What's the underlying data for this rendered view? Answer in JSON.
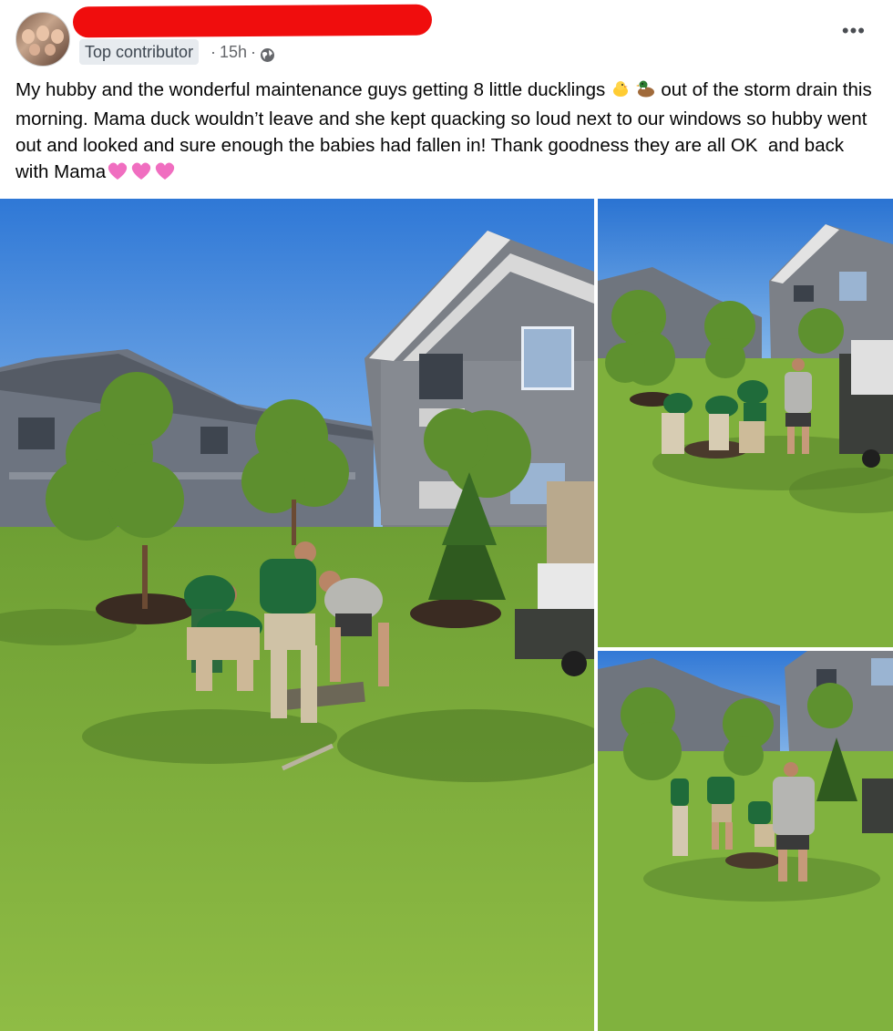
{
  "post": {
    "author_badge": "Top contributor",
    "timestamp": "15h",
    "separator": "·",
    "more_label": "•••",
    "text_main": "My hubby and the wonderful maintenance guys getting 8 little ducklings ",
    "text_after_emoji": " out of the storm drain this morning. Mama duck wouldn’t leave and she kept quacking so loud next to our windows so hubby went out and looked and sure enough the babies had fallen in! Thank goodness they are all OK  and back with Mama",
    "emojis": [
      "duckling-emoji",
      "duck-emoji",
      "pink-heart-emoji",
      "pink-heart-emoji",
      "pink-heart-emoji"
    ]
  },
  "colors": {
    "redaction": "#f00d0d",
    "badge_bg": "#e7ebef",
    "meta_text": "#65676b",
    "grass": "#7cae3c",
    "sky": "#4a90d9",
    "heart": "#f06ec0"
  },
  "photos": [
    {
      "name": "photo-main-crew-at-drain"
    },
    {
      "name": "photo-crew-wide-view"
    },
    {
      "name": "photo-crew-far-view"
    }
  ]
}
